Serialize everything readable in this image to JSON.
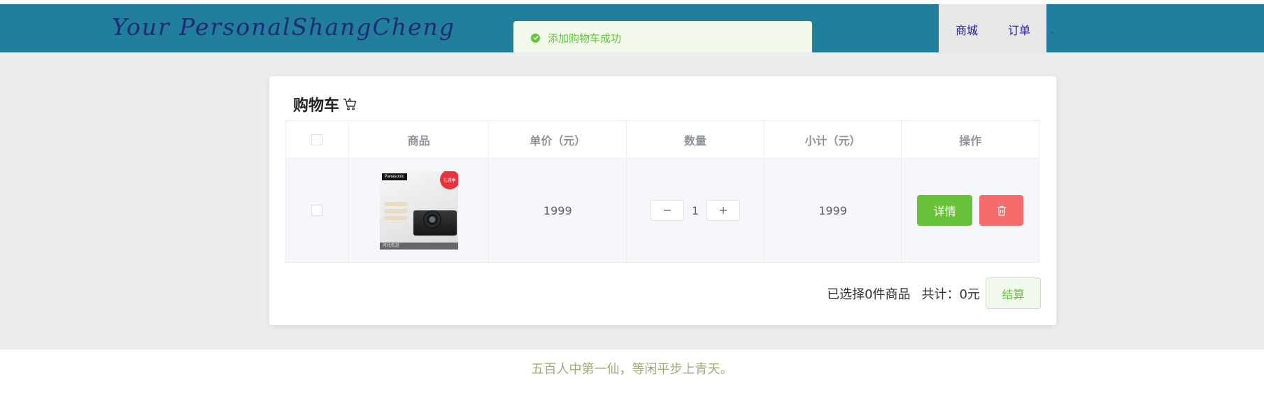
{
  "header": {
    "logo_text": "Your PersonalShangCheng",
    "nav": {
      "mall": "商城",
      "orders": "订单"
    }
  },
  "toast": {
    "message": "添加购物车成功"
  },
  "cart": {
    "title": "购物车",
    "columns": [
      "商品",
      "单价（元）",
      "数量",
      "小计（元）",
      "操作"
    ],
    "items": [
      {
        "image_brand": "Panasonic",
        "image_badge": "礼遇季",
        "image_caption": "河北先进",
        "price": "1999",
        "quantity": "1",
        "subtotal": "1999",
        "detail_label": "详情"
      }
    ],
    "summary": {
      "selected": "已选择0件商品",
      "total": "共计：0元"
    },
    "checkout_label": "结算"
  },
  "footer": {
    "quote": "五百人中第一仙，等闲平步上青天。"
  },
  "colors": {
    "header": "#217e9d",
    "success": "#67c23a",
    "danger": "#f56c6c",
    "page_band": "#ececec"
  }
}
